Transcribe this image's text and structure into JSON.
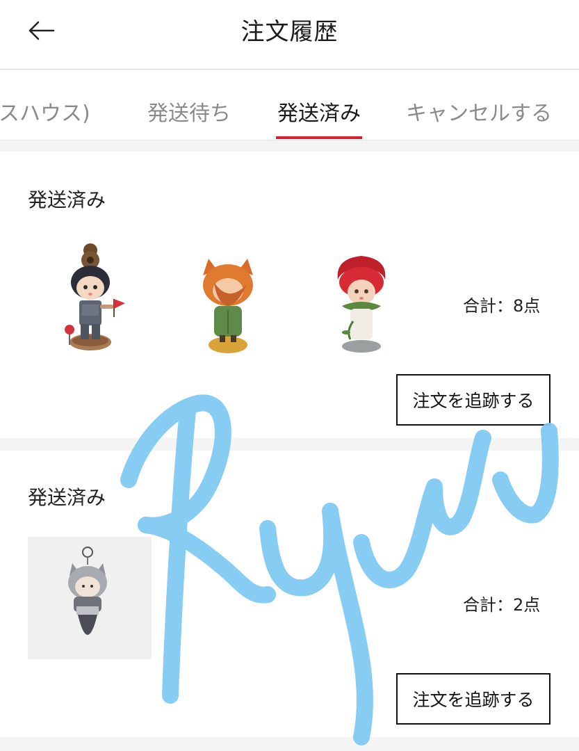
{
  "header": {
    "title": "注文履歴"
  },
  "tabs": [
    {
      "label": "スハウス)"
    },
    {
      "label": "発送待ち"
    },
    {
      "label": "発送済み"
    },
    {
      "label": "キャンセルする"
    }
  ],
  "orders": [
    {
      "status": "発送済み",
      "total": "合計：8点",
      "track_label": "注文を追跡する"
    },
    {
      "status": "発送済み",
      "total": "合計：2点",
      "track_label": "注文を追跡する"
    }
  ],
  "colors": {
    "accent": "#d6232f",
    "signature": "#7cc8f2"
  },
  "icons": {
    "back": "arrow-left-icon"
  }
}
